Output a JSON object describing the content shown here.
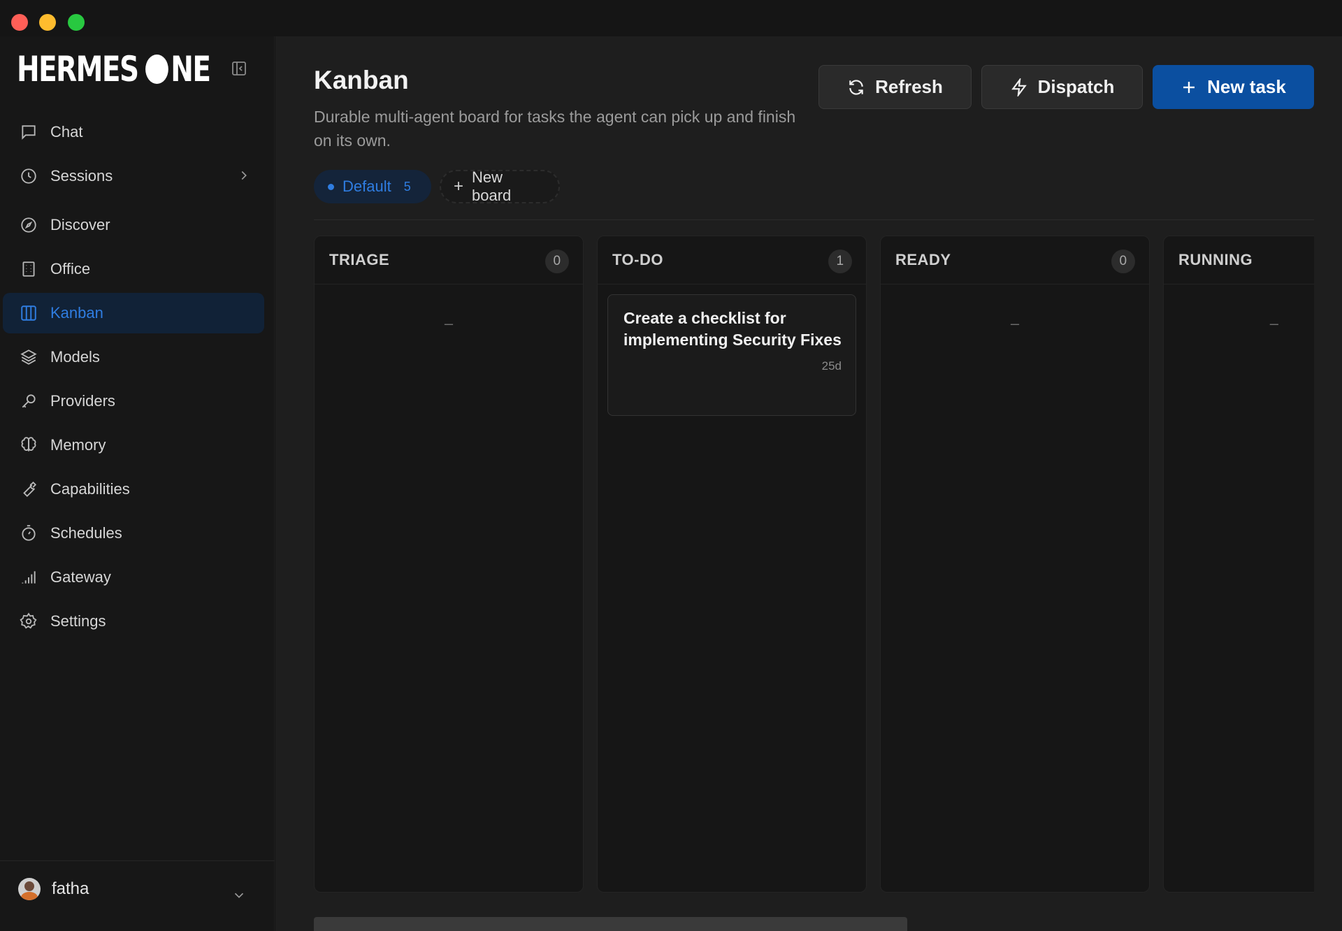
{
  "app": {
    "name": "HERMES ONE"
  },
  "sidebar": {
    "items": [
      {
        "label": "Chat",
        "icon": "chat-icon"
      },
      {
        "label": "Sessions",
        "icon": "clock-icon"
      },
      {
        "label": "Discover",
        "icon": "compass-icon"
      },
      {
        "label": "Office",
        "icon": "building-icon"
      },
      {
        "label": "Kanban",
        "icon": "kanban-icon",
        "active": true
      },
      {
        "label": "Models",
        "icon": "layers-icon"
      },
      {
        "label": "Providers",
        "icon": "key-icon"
      },
      {
        "label": "Memory",
        "icon": "brain-icon"
      },
      {
        "label": "Capabilities",
        "icon": "wrench-icon"
      },
      {
        "label": "Schedules",
        "icon": "timer-icon"
      },
      {
        "label": "Gateway",
        "icon": "signal-icon"
      },
      {
        "label": "Settings",
        "icon": "gear-icon"
      }
    ],
    "user": {
      "name": "fatha"
    }
  },
  "page": {
    "title": "Kanban",
    "description": "Durable multi-agent board for tasks the agent can pick up and finish on its own."
  },
  "toolbar": {
    "refresh_label": "Refresh",
    "dispatch_label": "Dispatch",
    "new_task_label": "New task"
  },
  "boards": {
    "default": {
      "label": "Default",
      "count": "5"
    },
    "new_board_label": "New board"
  },
  "columns": [
    {
      "title": "TRIAGE",
      "count": "0",
      "empty": "–"
    },
    {
      "title": "TO-DO",
      "count": "1",
      "cards": [
        {
          "title": "Create a checklist for implementing Security Fixes",
          "age": "25d"
        }
      ]
    },
    {
      "title": "READY",
      "count": "0",
      "empty": "–"
    },
    {
      "title": "RUNNING",
      "empty": "–"
    }
  ],
  "colors": {
    "accent": "#2f7de1",
    "primary_button": "#0b4fa0",
    "background": "#1e1e1e",
    "sidebar": "#171717"
  }
}
